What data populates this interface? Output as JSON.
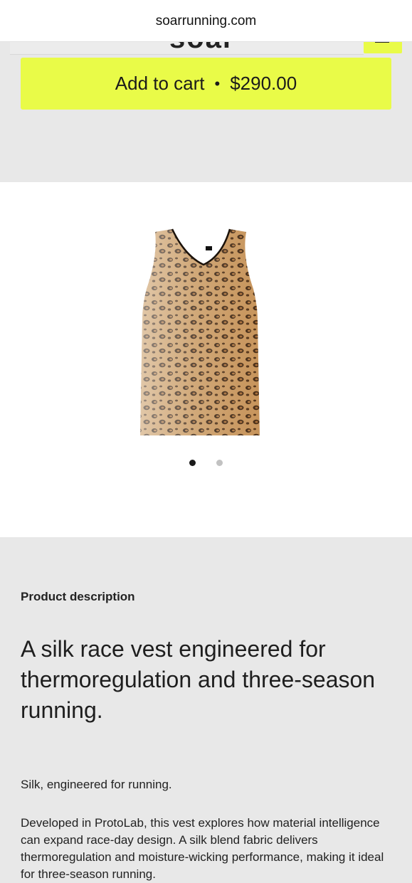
{
  "browser": {
    "url": "soarrunning.com"
  },
  "header": {
    "logo_text": "soar"
  },
  "cart": {
    "label": "Add to cart",
    "separator": "•",
    "price": "$290.00"
  },
  "gallery": {
    "image": "leopard-print-silk-vest",
    "slide_count": 2,
    "active_slide": 1
  },
  "description": {
    "heading": "Product description",
    "title": "A silk race vest engineered for thermoregulation and three-season running.",
    "paragraph_1": "Silk, engineered for running.",
    "paragraph_2": "Developed in ProtoLab, this vest explores how material intelligence can expand race-day design. A silk blend fabric delivers thermoregulation and moisture-wicking performance, making it ideal for three-season running."
  },
  "colors": {
    "accent": "#e9fb48",
    "page_bg": "#e8e8e8",
    "gallery_bg": "#ffffff"
  }
}
